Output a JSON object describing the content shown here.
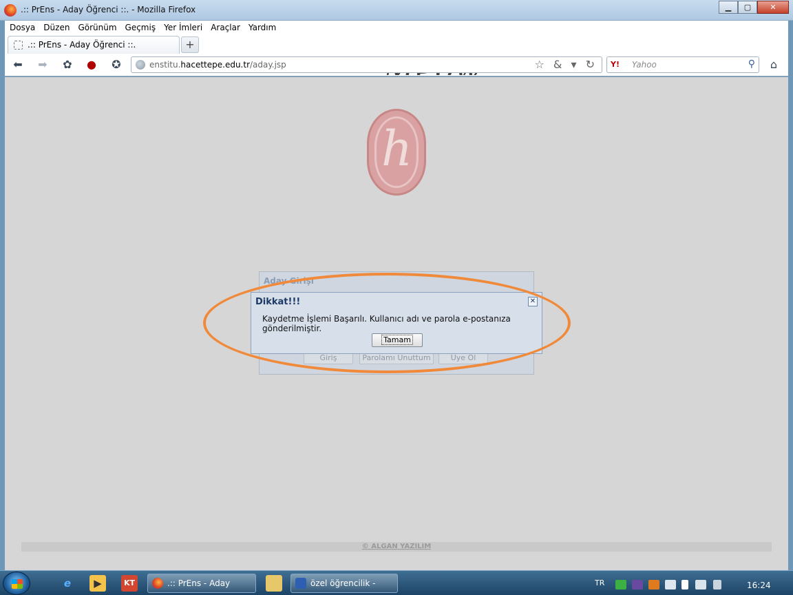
{
  "window": {
    "title": ".:: PrEns - Aday Öğrenci ::. - Mozilla Firefox",
    "min_glyph": "▁",
    "max_glyph": "▢",
    "close_glyph": "✕"
  },
  "menu": {
    "items": [
      "Dosya",
      "Düzen",
      "Görünüm",
      "Geçmiş",
      "Yer İmleri",
      "Araçlar",
      "Yardım"
    ]
  },
  "tabs": {
    "active_label": ".:: PrEns - Aday Öğrenci ::.",
    "new_tab_glyph": "+"
  },
  "nav": {
    "url_host_prefix": "enstitu.",
    "url_host_main": "hacettepe.edu.tr",
    "url_path": "/aday.jsp",
    "url_icons": "☆ & ▾ ↻",
    "search_engine_icon": "Y!",
    "search_placeholder": "Yahoo",
    "decor_text": "Meow"
  },
  "login": {
    "header": "Aday Girişi",
    "buttons": [
      "Giriş",
      "Parolamı Unuttum",
      "Üye Ol"
    ]
  },
  "dialog": {
    "title": "Dikkat!!!",
    "message": "Kaydetme İşlemi Başarılı. Kullanıcı adı ve parola e-postanıza gönderilmiştir.",
    "button": "Tamam",
    "close_glyph": "✕"
  },
  "footer": {
    "text": "© ALGAN YAZILIM"
  },
  "taskbar": {
    "tasks": [
      ".:: PrEns - Aday Öğre...",
      "özel öğrencilik - Micr..."
    ],
    "lang": "TR",
    "time": "16:24"
  },
  "colors": {
    "highlight": "#f08a3a",
    "logo": "#d9a1a1",
    "dialog_title": "#1d3a67"
  }
}
